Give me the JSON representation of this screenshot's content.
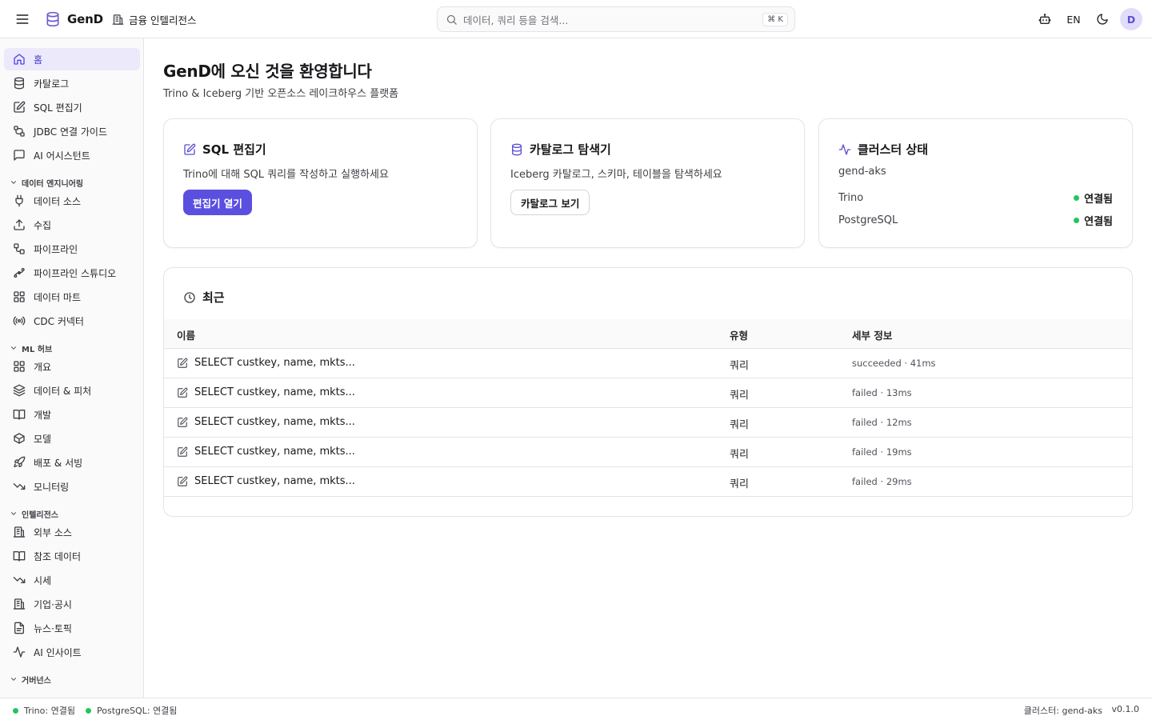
{
  "app": {
    "brand_name": "GenD",
    "workspace_name": "금융 인텔리전스"
  },
  "header": {
    "search_placeholder": "데이터, 쿼리 등을 검색...",
    "search_shortcut": "⌘ K",
    "language": "EN",
    "avatar_initial": "D"
  },
  "sidebar": {
    "top_items": [
      {
        "label": "홈",
        "icon": "home-icon",
        "active": true
      },
      {
        "label": "카탈로그",
        "icon": "database-icon"
      },
      {
        "label": "SQL 편집기",
        "icon": "edit-icon"
      },
      {
        "label": "JDBC 연결 가이드",
        "icon": "jdbc-cable-icon"
      },
      {
        "label": "AI 어시스턴트",
        "icon": "message-square-icon"
      }
    ],
    "sections": [
      {
        "title": "데이터 엔지니어링",
        "items": [
          {
            "label": "데이터 소스",
            "icon": "plug-icon"
          },
          {
            "label": "수집",
            "icon": "upload-icon"
          },
          {
            "label": "파이프라인",
            "icon": "workflow-icon"
          },
          {
            "label": "파이프라인 스튜디오",
            "icon": "spline-icon"
          },
          {
            "label": "데이터 마트",
            "icon": "grid-icon"
          },
          {
            "label": "CDC 커넥터",
            "icon": "radio-icon"
          }
        ]
      },
      {
        "title": "ML 허브",
        "items": [
          {
            "label": "개요",
            "icon": "grid-icon"
          },
          {
            "label": "데이터 & 피처",
            "icon": "layers-icon"
          },
          {
            "label": "개발",
            "icon": "book-icon"
          },
          {
            "label": "모델",
            "icon": "box-icon"
          },
          {
            "label": "배포 & 서빙",
            "icon": "rocket-icon"
          },
          {
            "label": "모니터링",
            "icon": "trending-down-icon"
          }
        ]
      },
      {
        "title": "인텔리전스",
        "items": [
          {
            "label": "외부 소스",
            "icon": "building-icon"
          },
          {
            "label": "참조 데이터",
            "icon": "book-icon"
          },
          {
            "label": "시세",
            "icon": "trending-down-icon"
          },
          {
            "label": "기업·공시",
            "icon": "building-icon"
          },
          {
            "label": "뉴스·토픽",
            "icon": "file-text-icon"
          },
          {
            "label": "AI 인사이트",
            "icon": "activity-icon"
          }
        ]
      },
      {
        "title": "거버넌스",
        "items": []
      }
    ]
  },
  "main": {
    "title": "GenD에 오신 것을 환영합니다",
    "subtitle": "Trino & Iceberg 기반 오픈소스 레이크하우스 플랫폼",
    "cards": {
      "sql_editor": {
        "title": "SQL 편집기",
        "description": "Trino에 대해 SQL 쿼리를 작성하고 실행하세요",
        "button": "편집기 열기"
      },
      "catalog": {
        "title": "카탈로그 탐색기",
        "description": "Iceberg 카탈로그, 스키마, 테이블을 탐색하세요",
        "button": "카탈로그 보기"
      },
      "cluster": {
        "title": "클러스터 상태",
        "cluster_name": "gend-aks",
        "services": [
          {
            "name": "Trino",
            "status": "연결됨"
          },
          {
            "name": "PostgreSQL",
            "status": "연결됨"
          }
        ]
      }
    },
    "recent": {
      "title": "최근",
      "columns": [
        "이름",
        "유형",
        "세부 정보"
      ],
      "rows": [
        {
          "name": "SELECT custkey, name, mkts...",
          "type": "쿼리",
          "detail": "succeeded · 41ms"
        },
        {
          "name": "SELECT custkey, name, mkts...",
          "type": "쿼리",
          "detail": "failed · 13ms"
        },
        {
          "name": "SELECT custkey, name, mkts...",
          "type": "쿼리",
          "detail": "failed · 12ms"
        },
        {
          "name": "SELECT custkey, name, mkts...",
          "type": "쿼리",
          "detail": "failed · 19ms"
        },
        {
          "name": "SELECT custkey, name, mkts...",
          "type": "쿼리",
          "detail": "failed · 29ms"
        }
      ]
    }
  },
  "statusbar": {
    "trino": "Trino: 연결됨",
    "postgres": "PostgreSQL: 연결됨",
    "cluster": "클러스터: gend-aks",
    "version": "v0.1.0"
  },
  "colors": {
    "accent": "#5b4fe0",
    "active_bg": "#ece9fb",
    "connected": "#22c55e"
  }
}
